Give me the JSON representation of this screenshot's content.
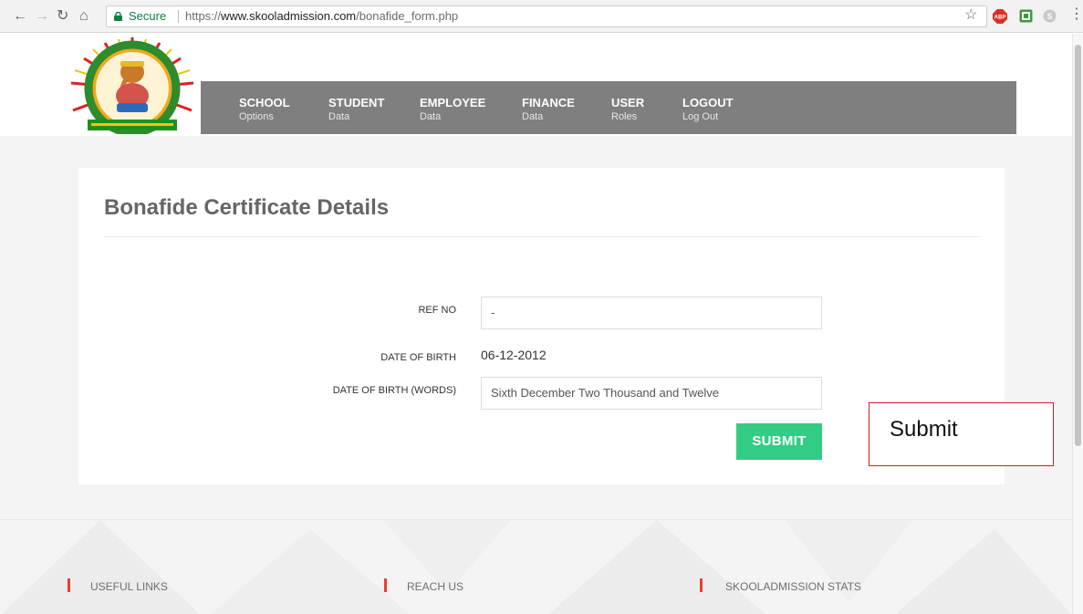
{
  "browser": {
    "secure_label": "Secure",
    "url_scheme": "https://",
    "url_host": "www.skooladmission.com",
    "url_path": "/bonafide_form.php",
    "secure_color": "#0b8043"
  },
  "menu": {
    "items": [
      {
        "title": "SCHOOL",
        "sub": "Options"
      },
      {
        "title": "STUDENT",
        "sub": "Data"
      },
      {
        "title": "EMPLOYEE",
        "sub": "Data"
      },
      {
        "title": "FINANCE",
        "sub": "Data"
      },
      {
        "title": "USER",
        "sub": "Roles"
      },
      {
        "title": "LOGOUT",
        "sub": "Log Out"
      }
    ],
    "bg_color": "#7f7f7f"
  },
  "form": {
    "title": "Bonafide Certificate Details",
    "ref_no_label": "REF NO",
    "ref_no_value": "-",
    "dob_label": "DATE OF BIRTH",
    "dob_value": "06-12-2012",
    "dob_words_label": "DATE OF BIRTH (WORDS)",
    "dob_words_value": "Sixth December Two Thousand and Twelve",
    "submit_label": "SUBMIT",
    "submit_color": "#33cc85"
  },
  "annotation": {
    "text": "Submit",
    "border_color": "#d02020"
  },
  "footer": {
    "headings": [
      "USEFUL LINKS",
      "REACH US",
      "SKOOLADMISSION STATS"
    ],
    "accent_color": "#e8402f"
  },
  "icons": [
    "back-icon",
    "forward-icon",
    "reload-icon",
    "home-icon",
    "lock-icon",
    "star-icon",
    "adblock-icon",
    "extension-icon",
    "skype-icon",
    "menu-icon"
  ]
}
